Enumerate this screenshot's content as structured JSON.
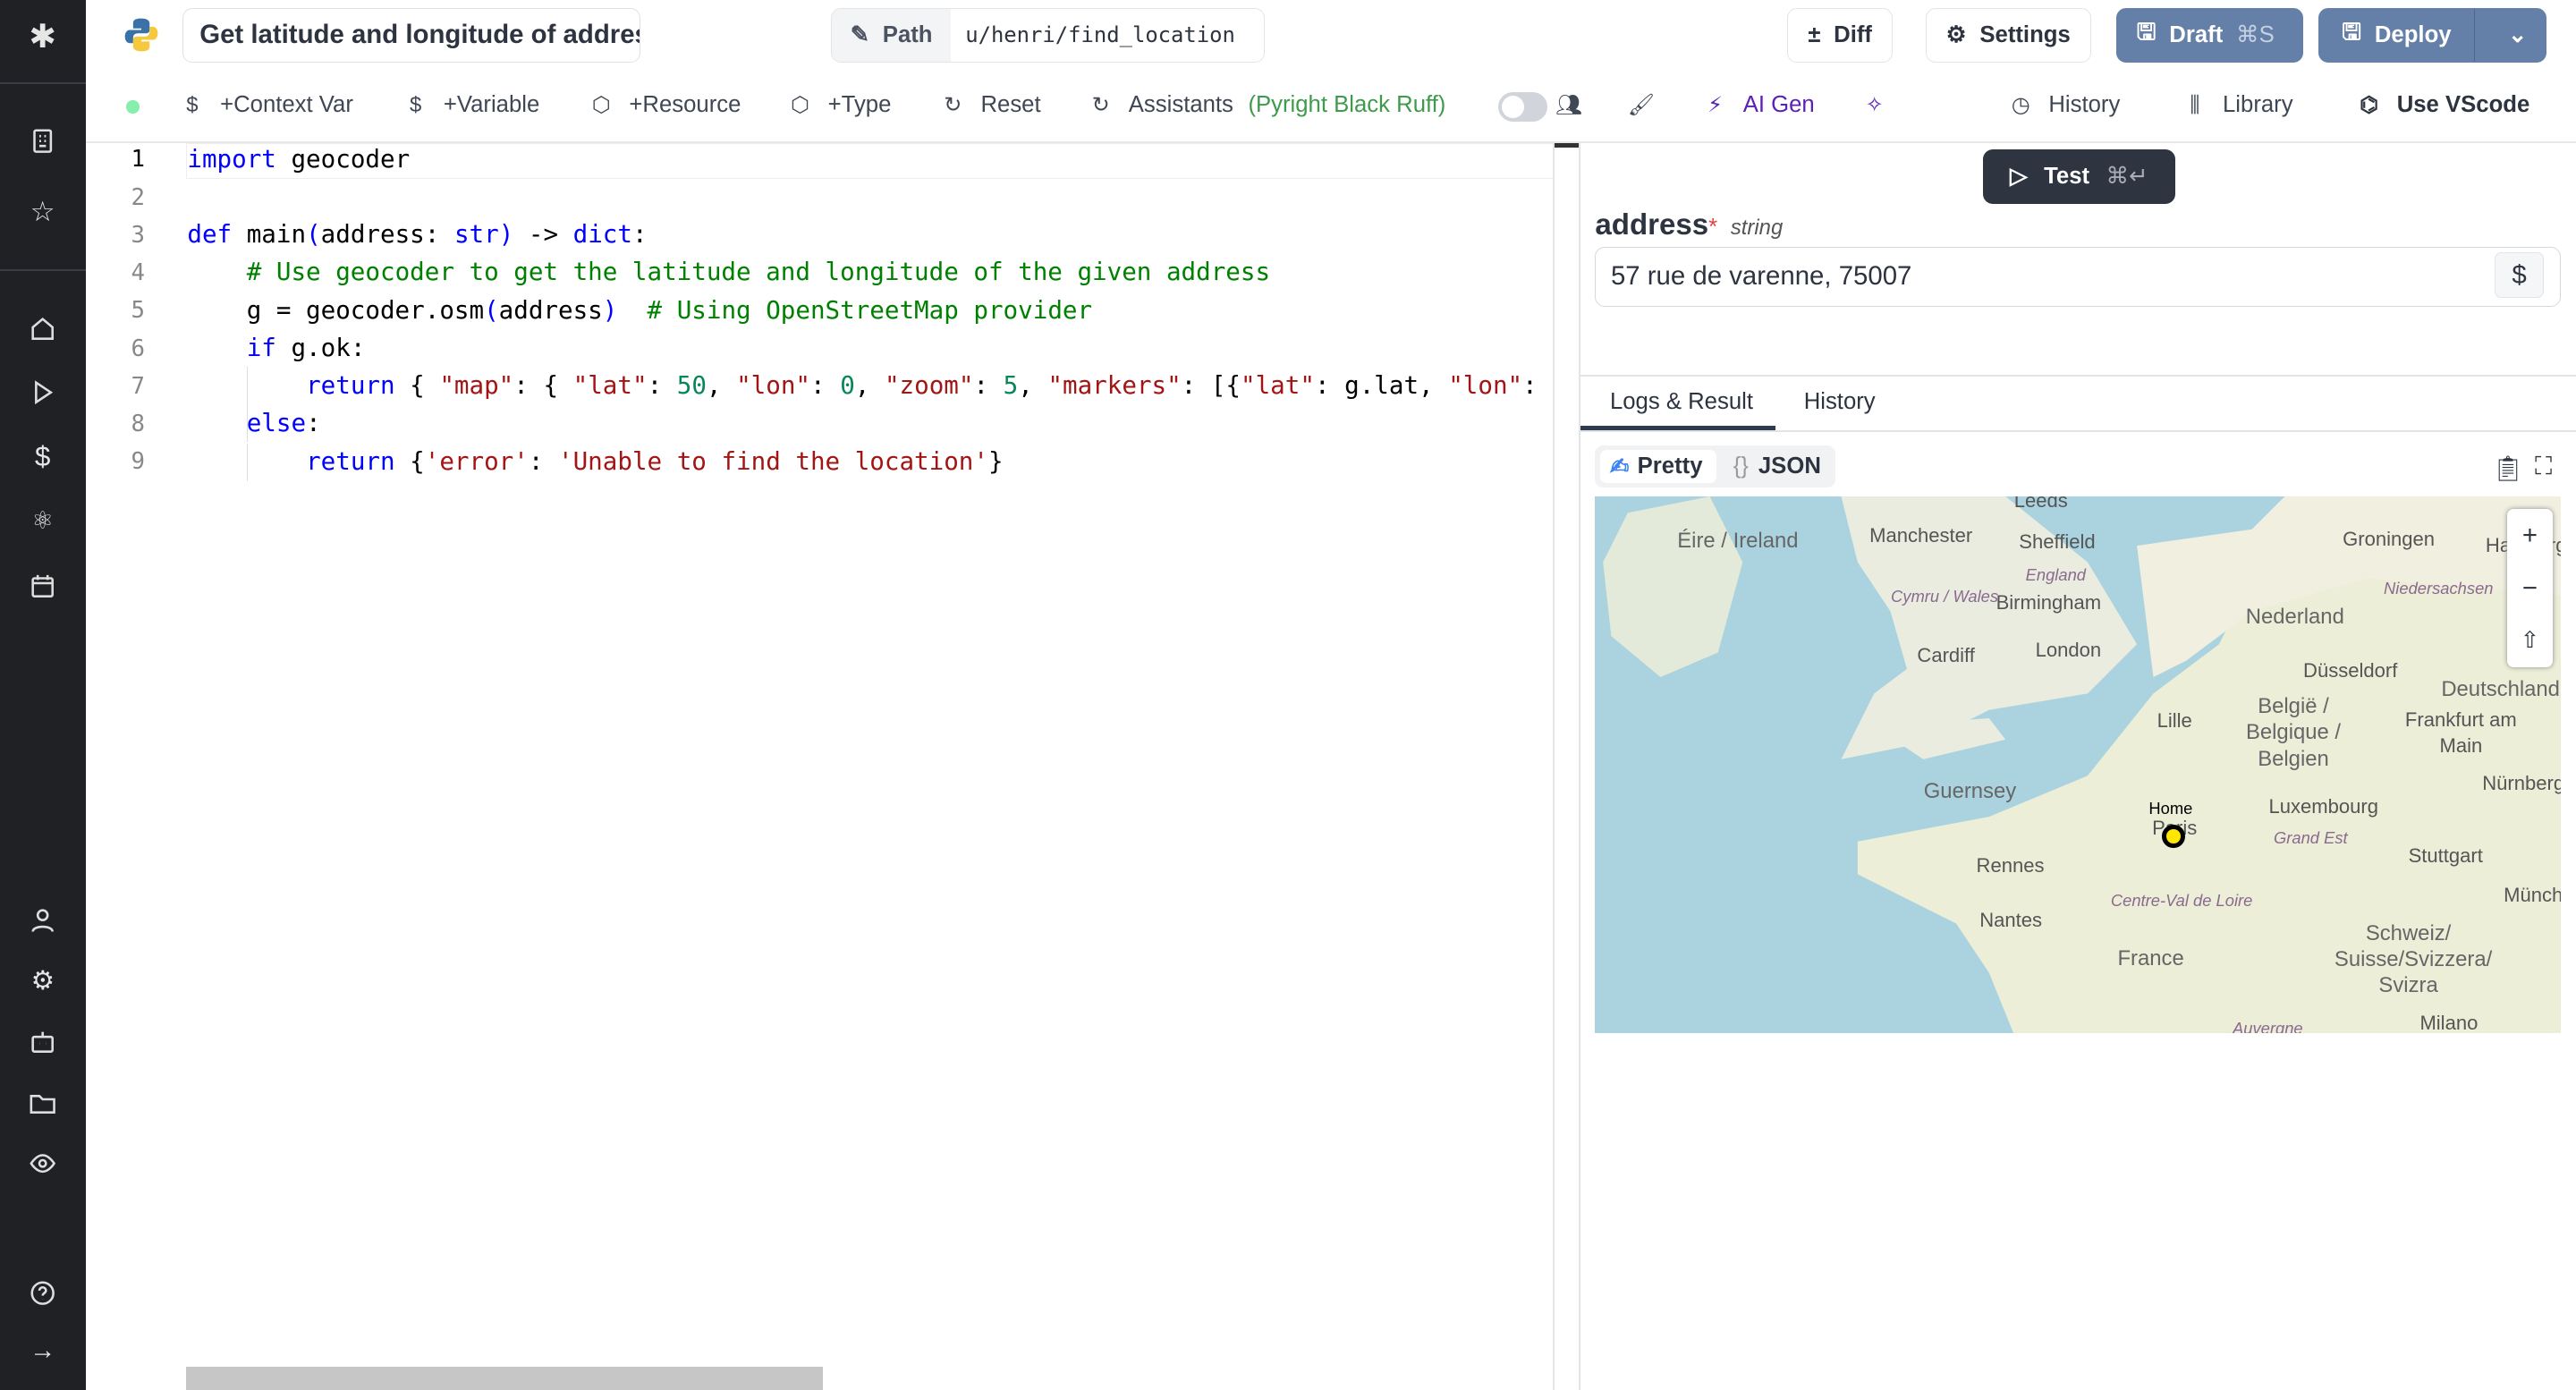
{
  "header": {
    "title": "Get latitude and longitude of address",
    "path_label": "Path",
    "path_value": "u/henri/find_location",
    "diff": "Diff",
    "settings": "Settings",
    "draft": "Draft",
    "draft_shortcut": "⌘S",
    "deploy": "Deploy"
  },
  "toolbar": {
    "context_var": "+Context Var",
    "variable": "+Variable",
    "resource": "+Resource",
    "type": "+Type",
    "reset": "Reset",
    "assistants": "Assistants",
    "assistants_detail": "(Pyright Black Ruff)",
    "ai_gen": "AI Gen",
    "history": "History",
    "library": "Library",
    "use_vscode": "Use VScode",
    "status_color": "#86efac"
  },
  "editor": {
    "line_numbers": [
      "1",
      "2",
      "3",
      "4",
      "5",
      "6",
      "7",
      "8",
      "9"
    ],
    "lines": [
      [
        {
          "k": "k",
          "t": "import"
        },
        {
          "k": "p",
          "t": " geocoder"
        }
      ],
      [],
      [
        {
          "k": "k",
          "t": "def"
        },
        {
          "k": "p",
          "t": " main"
        },
        {
          "k": "k",
          "t": "("
        },
        {
          "k": "p",
          "t": "address: "
        },
        {
          "k": "k",
          "t": "str"
        },
        {
          "k": "k",
          "t": ")"
        },
        {
          "k": "p",
          "t": " -> "
        },
        {
          "k": "k",
          "t": "dict"
        },
        {
          "k": "p",
          "t": ":"
        }
      ],
      [
        {
          "k": "p",
          "t": "    "
        },
        {
          "k": "c",
          "t": "# Use geocoder to get the latitude and longitude of the given address"
        }
      ],
      [
        {
          "k": "p",
          "t": "    g = geocoder.osm"
        },
        {
          "k": "k",
          "t": "("
        },
        {
          "k": "p",
          "t": "address"
        },
        {
          "k": "k",
          "t": ")"
        },
        {
          "k": "p",
          "t": "  "
        },
        {
          "k": "c",
          "t": "# Using OpenStreetMap provider"
        }
      ],
      [
        {
          "k": "p",
          "t": "    "
        },
        {
          "k": "k",
          "t": "if"
        },
        {
          "k": "p",
          "t": " g.ok:"
        }
      ],
      [
        {
          "k": "p",
          "t": "        "
        },
        {
          "k": "k",
          "t": "return"
        },
        {
          "k": "p",
          "t": " { "
        },
        {
          "k": "s",
          "t": "\"map\""
        },
        {
          "k": "p",
          "t": ": { "
        },
        {
          "k": "s",
          "t": "\"lat\""
        },
        {
          "k": "p",
          "t": ": "
        },
        {
          "k": "n",
          "t": "50"
        },
        {
          "k": "p",
          "t": ", "
        },
        {
          "k": "s",
          "t": "\"lon\""
        },
        {
          "k": "p",
          "t": ": "
        },
        {
          "k": "n",
          "t": "0"
        },
        {
          "k": "p",
          "t": ", "
        },
        {
          "k": "s",
          "t": "\"zoom\""
        },
        {
          "k": "p",
          "t": ": "
        },
        {
          "k": "n",
          "t": "5"
        },
        {
          "k": "p",
          "t": ", "
        },
        {
          "k": "s",
          "t": "\"markers\""
        },
        {
          "k": "p",
          "t": ": [{"
        },
        {
          "k": "s",
          "t": "\"lat\""
        },
        {
          "k": "p",
          "t": ": g.lat, "
        },
        {
          "k": "s",
          "t": "\"lon\""
        },
        {
          "k": "p",
          "t": ": g"
        }
      ],
      [
        {
          "k": "p",
          "t": "    "
        },
        {
          "k": "k",
          "t": "else"
        },
        {
          "k": "p",
          "t": ":"
        }
      ],
      [
        {
          "k": "p",
          "t": "        "
        },
        {
          "k": "k",
          "t": "return"
        },
        {
          "k": "p",
          "t": " {"
        },
        {
          "k": "s",
          "t": "'error'"
        },
        {
          "k": "p",
          "t": ": "
        },
        {
          "k": "s",
          "t": "'Unable to find the location'"
        },
        {
          "k": "p",
          "t": "}"
        }
      ]
    ]
  },
  "test": {
    "label": "Test",
    "shortcut": "⌘↵"
  },
  "form": {
    "field_name": "address",
    "required": "*",
    "field_type": "string",
    "value": "57 rue de varenne, 75007"
  },
  "results": {
    "tabs": [
      "Logs & Result",
      "History"
    ],
    "view_pretty": "Pretty",
    "view_json": "JSON"
  },
  "map": {
    "marker_label": "Home",
    "labels": [
      "Leeds",
      "Éire / Ireland",
      "Manchester",
      "Sheffield",
      "England",
      "Cymru / Wales",
      "Birmingham",
      "Cardiff",
      "London",
      "Groningen",
      "Hamburg",
      "Niedersachsen",
      "Nederland",
      "Düsseldorf",
      "Deutschland",
      "België / Belgique / Belgien",
      "Lille",
      "Frankfurt am Main",
      "Guernsey",
      "Paris",
      "Luxembourg",
      "Nürnberg",
      "Grand Est",
      "Rennes",
      "Stuttgart",
      "Centre-Val de Loire",
      "Nantes",
      "München",
      "France",
      "Schweiz/ Suisse/Svizzera/ Svizra",
      "Milano",
      "Auvergne"
    ],
    "sea_color": "#aad3df",
    "land_color": "#f2efe9"
  }
}
